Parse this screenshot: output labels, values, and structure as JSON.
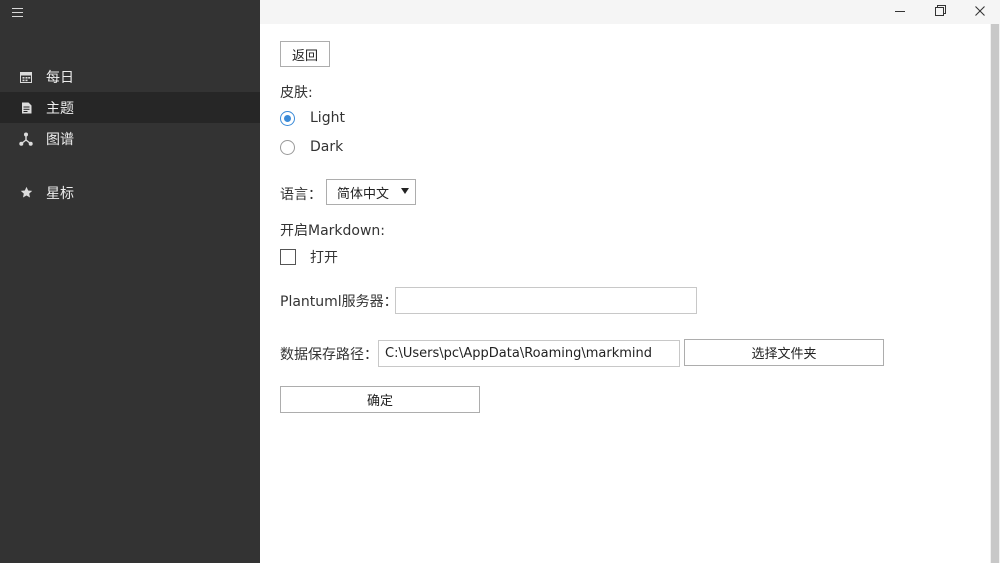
{
  "sidebar": {
    "menu_icon": "hamburger-icon",
    "items": [
      {
        "label": "每日",
        "icon": "calendar-icon"
      },
      {
        "label": "主题",
        "icon": "document-icon",
        "active": true
      },
      {
        "label": "图谱",
        "icon": "graph-icon"
      },
      {
        "label": "星标",
        "icon": "star-icon"
      }
    ]
  },
  "window": {
    "controls": [
      "minimize-icon",
      "restore-icon",
      "close-icon"
    ]
  },
  "settings": {
    "back_label": "返回",
    "skin_label": "皮肤:",
    "skin_options": [
      {
        "label": "Light",
        "checked": true
      },
      {
        "label": "Dark",
        "checked": false
      }
    ],
    "language_label": "语言：",
    "language_value": "简体中文",
    "markdown_label": "开启Markdown:",
    "markdown_option_label": "打开",
    "markdown_checked": false,
    "plantuml_label": "Plantuml服务器：",
    "plantuml_value": "",
    "data_path_label": "数据保存路径：",
    "data_path_value": "C:\\Users\\pc\\AppData\\Roaming\\markmind",
    "choose_folder_label": "选择文件夹",
    "confirm_label": "确定"
  },
  "colors": {
    "sidebar_bg": "#333333",
    "sidebar_active_bg": "#262626",
    "accent": "#3b8bd8"
  }
}
